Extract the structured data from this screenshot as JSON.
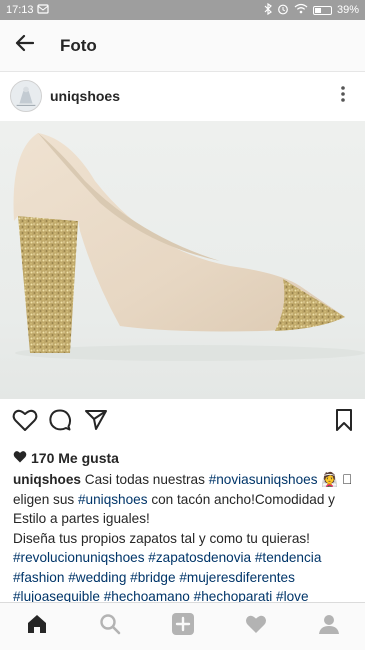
{
  "status_bar": {
    "time": "17:13",
    "battery": "39%",
    "icons": [
      "notification-icon",
      "bluetooth-icon",
      "alarm-icon",
      "wifi-icon",
      "battery-icon"
    ]
  },
  "header": {
    "title": "Foto",
    "back_icon": "arrow-left-icon"
  },
  "post": {
    "username": "uniqshoes",
    "image_alt": "shoe-photo",
    "likes": "170 Me gusta",
    "caption_user": "uniqshoes",
    "caption_parts": [
      {
        "t": "Casi todas nuestras ",
        "tag": false
      },
      {
        "t": "#noviasuniqshoes",
        "tag": true
      },
      {
        "t": " 👰 ",
        "tag": false
      },
      {
        "t": "🏼 eligen sus ",
        "tag": false
      },
      {
        "t": "#uniqshoes",
        "tag": true
      },
      {
        "t": " con tacón ancho!Comodidad y Estilo a partes iguales!",
        "tag": false
      },
      {
        "t": "\nDiseña tus propios zapatos tal y como tu quieras!\n",
        "tag": false
      },
      {
        "t": "#revolucionuniqshoes",
        "tag": true
      },
      {
        "t": " ",
        "tag": false
      },
      {
        "t": "#zapatosdenovia",
        "tag": true
      },
      {
        "t": " ",
        "tag": false
      },
      {
        "t": "#tendencia",
        "tag": true
      },
      {
        "t": "\n",
        "tag": false
      },
      {
        "t": "#fashion",
        "tag": true
      },
      {
        "t": " ",
        "tag": false
      },
      {
        "t": "#wedding",
        "tag": true
      },
      {
        "t": " ",
        "tag": false
      },
      {
        "t": "#bridge",
        "tag": true
      },
      {
        "t": " ",
        "tag": false
      },
      {
        "t": "#mujeresdiferentes",
        "tag": true
      },
      {
        "t": "\n",
        "tag": false
      },
      {
        "t": "#lujoasequible",
        "tag": true
      },
      {
        "t": " ",
        "tag": false
      },
      {
        "t": "#hechoamano",
        "tag": true
      },
      {
        "t": " ",
        "tag": false
      },
      {
        "t": "#hechoparati",
        "tag": true
      },
      {
        "t": " ",
        "tag": false
      },
      {
        "t": "#love",
        "tag": true
      }
    ]
  },
  "actions": [
    "heart-icon",
    "comment-icon",
    "share-icon",
    "bookmark-icon"
  ],
  "bottom_nav": [
    "home-icon",
    "search-icon",
    "add-icon",
    "activity-heart-icon",
    "profile-icon"
  ],
  "colors": {
    "status_bar": "#9e9e9e",
    "hashtag": "#003569",
    "text": "#262626",
    "nav_background": "#fafafa"
  }
}
